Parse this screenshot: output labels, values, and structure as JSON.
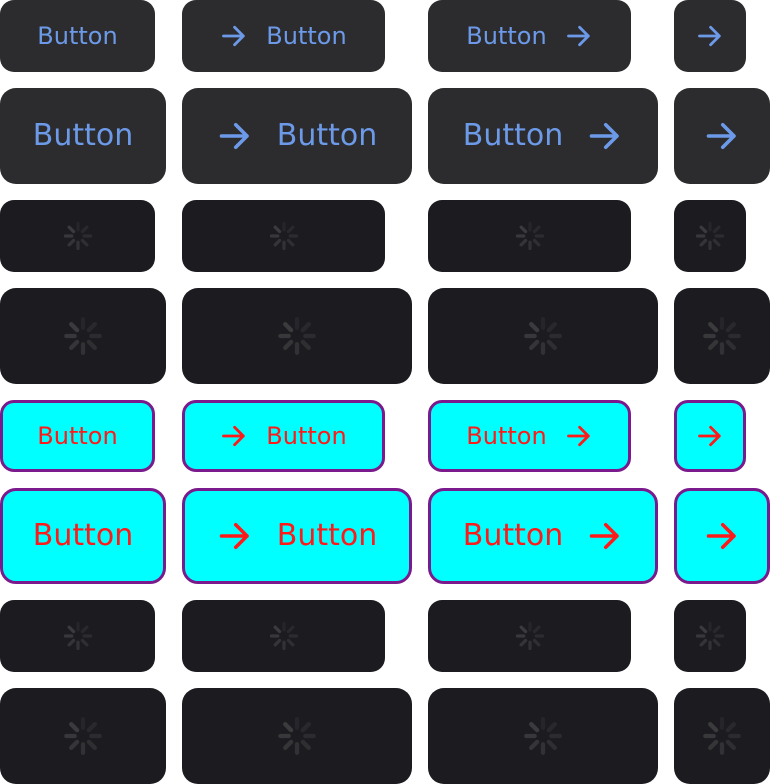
{
  "labels": {
    "button": "Button"
  },
  "icons": {
    "arrow": "arrow-right-icon",
    "spinner": "activity-spinner-icon"
  },
  "colors": {
    "page_background": "#ffffff",
    "filled_background": "#2c2c2e",
    "filled_text": "#6c9ae8",
    "loading_background": "#1c1b20",
    "spinner": "#3b3b3e",
    "highlight_background": "#00ffff",
    "highlight_text": "#ff1a1a",
    "highlight_border": "#7a1a8c"
  }
}
